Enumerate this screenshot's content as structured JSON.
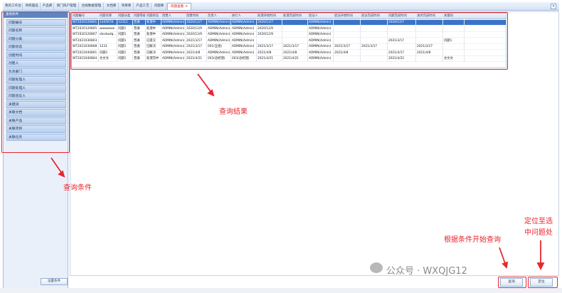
{
  "tabs": [
    {
      "label": "我的工作台",
      "active": false
    },
    {
      "label": "项目遴选",
      "active": false
    },
    {
      "label": "产品库",
      "active": false
    },
    {
      "label": "新门风户管理",
      "active": false
    },
    {
      "label": "合规数据管理",
      "active": false
    },
    {
      "label": "文档库",
      "active": false
    },
    {
      "label": "项目库",
      "active": false
    },
    {
      "label": "产品工艺",
      "active": false
    },
    {
      "label": "问题库",
      "active": false
    },
    {
      "label": "问题查看",
      "active": true
    }
  ],
  "left_panel": {
    "header": "查询条件",
    "fields": [
      "问题编号",
      "问题名称",
      "问题分类",
      "问题状态",
      "创建时间",
      "创建人",
      "负责部门",
      "问题处理人",
      "问题处理人",
      "问题验证人",
      "关键词",
      "关联文档",
      "关联产品",
      "关联项目",
      "关联任务"
    ],
    "save_button": "设置条件"
  },
  "grid": {
    "headers": [
      "问题编号",
      "问题名称",
      "问题分类",
      "问题等级",
      "问题状态",
      "创建人",
      "创建时间",
      "负责人",
      "执行人",
      "处理开始时间",
      "处理完成时间",
      "验证人",
      "验证开始时间",
      "验证完成时间",
      "问题完成时间",
      "关闭完成时间",
      "关键词"
    ],
    "rows": [
      [
        "WT2020120801",
        "1345678",
        "12312",
        "普通",
        "处理中",
        "ADMIN(Admin)",
        "2020/12/7",
        "ADMIN(Admin)",
        "ADMIN(Admin)",
        "2020/12/7",
        "",
        "ADMIN(Admin)",
        "",
        "",
        "2020/12/7",
        "",
        ""
      ],
      [
        "WT2020120805",
        "wwwwww",
        "问题1",
        "普通",
        "处理中",
        "ADMIN(Admin)",
        "2020/12/9",
        "ADMIN(Admin)",
        "ADMIN(Admin)",
        "2020/12/9",
        "",
        "ADMIN(Admin)",
        "",
        "",
        "",
        "",
        ""
      ],
      [
        "WT2020120807",
        "dasdwdq...",
        "问题1",
        "普通",
        "处理中",
        "ADMIN(Admin)",
        "2020/12/9",
        "ADMIN(Admin)",
        "ADMIN(Admin)",
        "2020/12/9",
        "",
        "ADMIN(Admin)",
        "",
        "",
        "",
        "",
        ""
      ],
      [
        "WT2021030803",
        "",
        "问题1",
        "普通",
        "已提交",
        "ADMIN(Admin)",
        "2021/3/17",
        "ADMIN(Admin)",
        "ADMIN(Admin)",
        "",
        "",
        "ADMIN(Admin)",
        "",
        "",
        "2021/3/17",
        "",
        "问题1"
      ],
      [
        "WT2021030808",
        "1231",
        "问题1",
        "普通",
        "已解决",
        "ADMIN(Admin)",
        "2021/3/17",
        "001(五组)",
        "ADMIN(Admin)",
        "2021/3/17",
        "2021/3/17",
        "ADMIN(Admin)",
        "2021/3/17",
        "2021/3/17",
        "",
        "2021/3/17",
        ""
      ],
      [
        "WT2021040801",
        "问题1",
        "问题1",
        "普通",
        "已解决",
        "ADMIN(Admin)",
        "2021/4/8",
        "ADMIN(Admin)",
        "ADMIN(Admin)",
        "2021/4/8",
        "2021/4/8",
        "ADMIN(Admin)",
        "2021/4/8",
        "",
        "2021/4/17",
        "2021/4/8",
        ""
      ],
      [
        "WT2021040804",
        "文文文",
        "问题1",
        "普通",
        "处理完中",
        "ADMIN(Admin)",
        "2021/4/21",
        "003(总经理)",
        "003(总经理)",
        "2021/4/21",
        "2021/4/21",
        "ADMIN(Admin)",
        "",
        "",
        "2021/4/22",
        "",
        "文文文"
      ]
    ]
  },
  "buttons": {
    "query": "查询",
    "locate": "定位"
  },
  "annotations": {
    "results": "查询结果",
    "conditions": "查询条件",
    "start_query": "根据条件开始查询",
    "locate_line1": "定位至选",
    "locate_line2": "中问题处"
  },
  "watermark": "公众号 · WXQJG12",
  "colors": {
    "annotation": "#e8262e",
    "selected_row": "#3a73c9"
  }
}
